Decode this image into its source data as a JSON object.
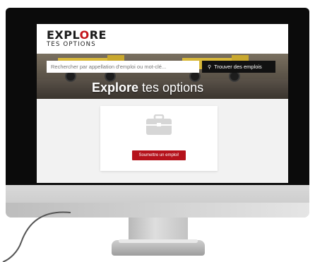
{
  "header": {
    "logo_line1_a": "EXPL",
    "logo_line1_accent": "O",
    "logo_line1_b": "RE",
    "logo_line2": "TES OPTIONS"
  },
  "search": {
    "placeholder": "Rechercher par appellation d'emploi ou mot-clé...",
    "button_label": "Trouver des emplois",
    "icon": "search-icon"
  },
  "hero": {
    "title_bold": "Explore",
    "title_rest": " tes options"
  },
  "card": {
    "icon": "briefcase-icon",
    "button_label": "Soumettre un emploi!"
  },
  "colors": {
    "accent_red": "#b5121b",
    "logo_red": "#c4161c",
    "search_button": "#111111",
    "truck_yellow": "#d8b83a"
  }
}
